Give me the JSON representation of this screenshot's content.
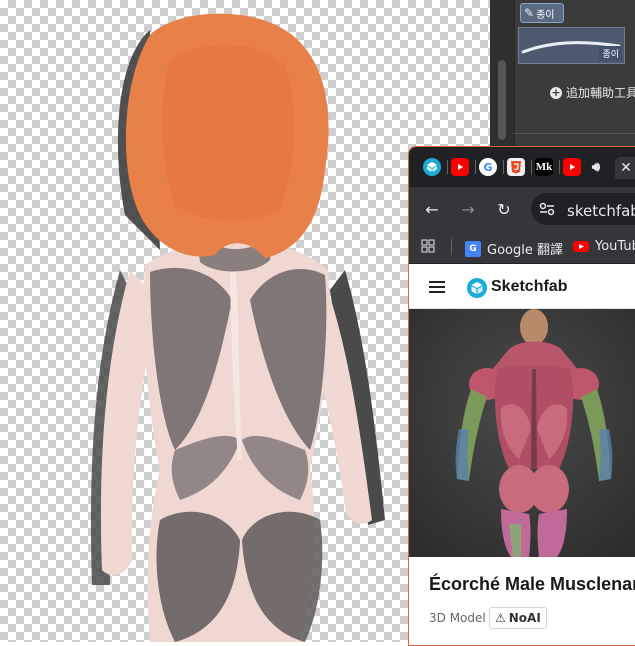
{
  "paint_panel": {
    "brush_tab_label": "종이",
    "brush_preview_label": "종이",
    "add_tool_label": "追加輔助工具"
  },
  "browser": {
    "tabs": [
      {
        "icon": "sketchfab-tab-icon",
        "color": "#1caad9"
      },
      {
        "icon": "youtube-tab-icon",
        "color": "#ff0000"
      },
      {
        "icon": "google-tab-icon",
        "color": "#ffffff"
      },
      {
        "icon": "html5-tab-icon",
        "color": "#e44d26"
      },
      {
        "icon": "mk-tab-icon",
        "color": "#000000"
      },
      {
        "icon": "youtube-tab-icon",
        "color": "#ff0000"
      }
    ],
    "mk_label": "Mk",
    "url": "sketchfab.com",
    "bookmarks": [
      {
        "label": "Google 翻譯",
        "icon": "google-translate-icon"
      },
      {
        "label": "YouTube",
        "icon": "youtube-icon"
      }
    ],
    "site": {
      "logo_text": "Sketchfab",
      "model_title": "Écorché Male Musclenames",
      "model_type": "3D Model",
      "badge": "NoAI"
    }
  },
  "colors": {
    "hair": "#e8804a",
    "accent_orange": "#d8663a",
    "sketchfab_blue": "#1caad9",
    "chrome_dark": "#202124",
    "chrome_toolbar": "#35363a"
  }
}
